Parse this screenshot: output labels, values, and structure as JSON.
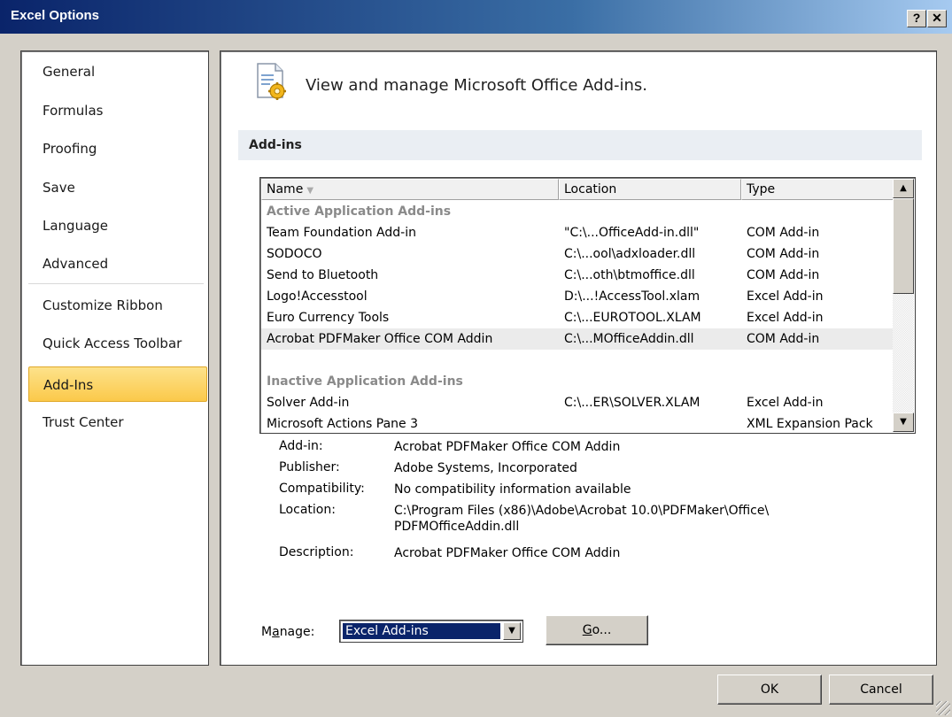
{
  "window": {
    "title": "Excel Options",
    "help_button": "?",
    "close_button": "✕"
  },
  "sidebar": {
    "items": [
      {
        "label": "General"
      },
      {
        "label": "Formulas"
      },
      {
        "label": "Proofing"
      },
      {
        "label": "Save"
      },
      {
        "label": "Language"
      },
      {
        "label": "Advanced"
      },
      {
        "label": "Customize Ribbon"
      },
      {
        "label": "Quick Access Toolbar"
      },
      {
        "label": "Add-Ins",
        "selected": true
      },
      {
        "label": "Trust Center"
      }
    ]
  },
  "main": {
    "heading": "View and manage Microsoft Office Add-ins.",
    "heading_icon": "addins-gear-icon",
    "section_title": "Add-ins",
    "columns": {
      "name": "Name",
      "location": "Location",
      "type": "Type"
    },
    "groups": [
      {
        "title": "Active Application Add-ins",
        "rows": [
          {
            "name": "Team Foundation Add-in",
            "location": "\"C:\\...OfficeAdd-in.dll\"",
            "type": "COM Add-in"
          },
          {
            "name": "SODOCO",
            "location": "C:\\...ool\\adxloader.dll",
            "type": "COM Add-in"
          },
          {
            "name": "Send to Bluetooth",
            "location": "C:\\...oth\\btmoffice.dll",
            "type": "COM Add-in"
          },
          {
            "name": "Logo!Accesstool",
            "location": "D:\\...!AccessTool.xlam",
            "type": "Excel Add-in"
          },
          {
            "name": "Euro Currency Tools",
            "location": "C:\\...EUROTOOL.XLAM",
            "type": "Excel Add-in"
          },
          {
            "name": "Acrobat PDFMaker Office COM Addin",
            "location": "C:\\...MOfficeAddin.dll",
            "type": "COM Add-in",
            "selected": true
          }
        ]
      },
      {
        "title": "Inactive Application Add-ins",
        "rows": [
          {
            "name": "Solver Add-in",
            "location": "C:\\...ER\\SOLVER.XLAM",
            "type": "Excel Add-in"
          },
          {
            "name": "Microsoft Actions Pane 3",
            "location": "",
            "type": "XML Expansion Pack"
          }
        ]
      }
    ],
    "details": {
      "addin_label": "Add-in:",
      "addin_value": "Acrobat PDFMaker Office COM Addin",
      "publisher_label": "Publisher:",
      "publisher_value": "Adobe Systems, Incorporated",
      "compat_label": "Compatibility:",
      "compat_value": "No compatibility information available",
      "location_label": "Location:",
      "location_value_1": "C:\\Program Files (x86)\\Adobe\\Acrobat 10.0\\PDFMaker\\Office\\",
      "location_value_2": "PDFMOfficeAddin.dll",
      "desc_label": "Description:",
      "desc_value": "Acrobat PDFMaker Office COM Addin"
    },
    "manage": {
      "label_pre": "M",
      "label_ul": "a",
      "label_post": "nage:",
      "selected": "Excel Add-ins",
      "go_ul": "G",
      "go_post": "o..."
    }
  },
  "footer": {
    "ok": "OK",
    "cancel": "Cancel"
  }
}
